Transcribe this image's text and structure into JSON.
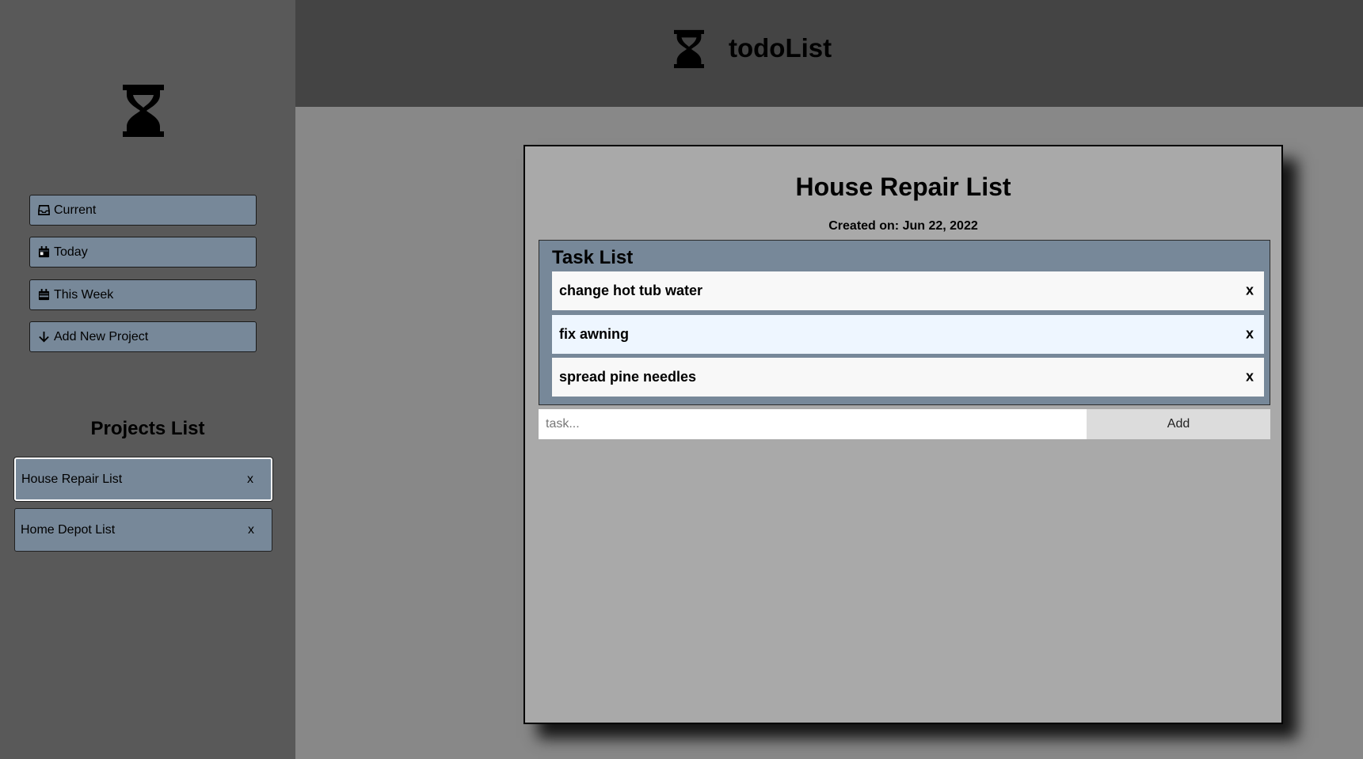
{
  "app": {
    "title": "todoList"
  },
  "sidebar": {
    "nav": [
      {
        "label": "Current",
        "icon": "inbox-icon"
      },
      {
        "label": "Today",
        "icon": "calendar-day-icon"
      },
      {
        "label": "This Week",
        "icon": "calendar-week-icon"
      },
      {
        "label": "Add New Project",
        "icon": "arrow-down-icon"
      }
    ],
    "projects_title": "Projects List",
    "projects": [
      {
        "name": "House Repair List",
        "delete": "x",
        "active": true
      },
      {
        "name": "Home Depot List",
        "delete": "x",
        "active": false
      }
    ]
  },
  "project": {
    "title": "House Repair List",
    "created": "Created on: Jun 22, 2022",
    "tasks_title": "Task List",
    "tasks": [
      {
        "text": "change hot tub water",
        "delete": "x"
      },
      {
        "text": "fix awning",
        "delete": "x"
      },
      {
        "text": "spread pine needles",
        "delete": "x"
      }
    ],
    "input_placeholder": "task...",
    "add_label": "Add"
  },
  "colors": {
    "sidebar_bg": "#595959",
    "header_bg": "#444444",
    "main_bg": "#888888",
    "panel_bg": "#a9a9a9",
    "accent": "#778899"
  }
}
